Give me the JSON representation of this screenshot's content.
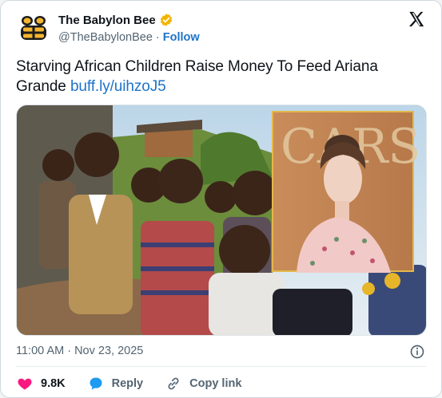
{
  "author": {
    "name": "The Babylon Bee",
    "handle": "@TheBabylonBee",
    "separator": "·",
    "follow_label": "Follow",
    "verified_color": "#f4b400"
  },
  "tweet": {
    "text": "Starving African Children Raise Money To Feed Ariana Grande",
    "link": "buff.ly/uihzoJ5",
    "timestamp": "11:00 AM · Nov 23, 2025"
  },
  "media": {
    "inset_lettering": "CARS"
  },
  "actions": {
    "like_count": "9.8K",
    "reply_label": "Reply",
    "copy_link_label": "Copy link"
  },
  "colors": {
    "like": "#f91880",
    "reply": "#1d9bf0",
    "link": "#1d73c9",
    "muted": "#536471"
  },
  "icons": {
    "brand": "x-logo-icon",
    "info": "info-icon",
    "like": "heart-icon",
    "reply": "reply-bubble-icon",
    "copy": "link-icon"
  }
}
